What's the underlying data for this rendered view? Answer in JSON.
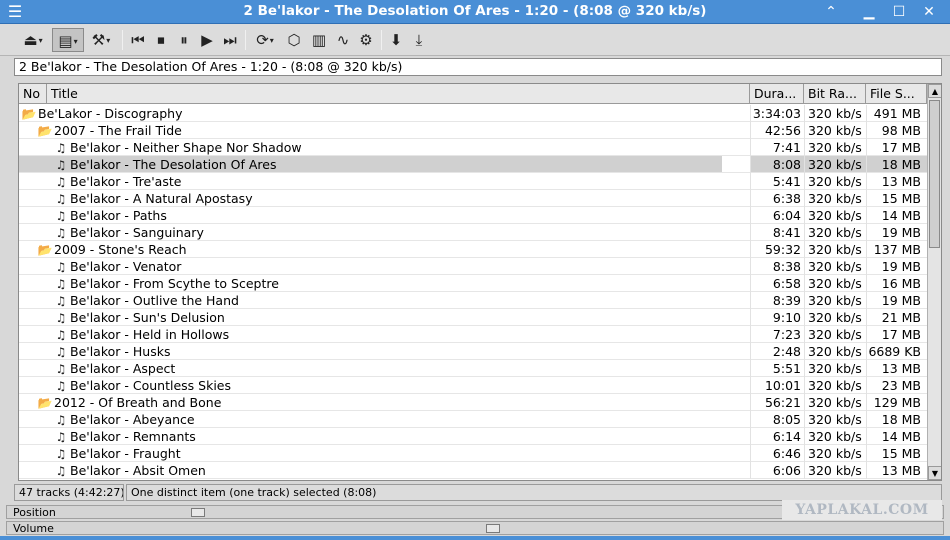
{
  "window": {
    "title": "2 Be'lakor - The Desolation Of Ares - 1:20 - (8:08 @ 320 kb/s)",
    "menu_icon": "hamburger-icon",
    "controls": [
      "minimize-icon",
      "restore-icon",
      "maximize-icon",
      "close-icon"
    ]
  },
  "toolbar": {
    "buttons": [
      {
        "name": "eject-icon",
        "glyph": "⏏",
        "dropdown": true
      },
      {
        "name": "playlist-icon",
        "glyph": "▤",
        "dropdown": true,
        "pressed": true
      },
      {
        "name": "tools-icon",
        "glyph": "⚒",
        "dropdown": true
      },
      {
        "name": "previous-icon",
        "glyph": "⏮"
      },
      {
        "name": "stop-icon",
        "glyph": "⏹"
      },
      {
        "name": "pause-icon",
        "glyph": "⏸"
      },
      {
        "name": "play-icon",
        "glyph": "▶"
      },
      {
        "name": "next-icon",
        "glyph": "⏭"
      },
      {
        "name": "repeat-icon",
        "glyph": "⟳",
        "dropdown": true
      },
      {
        "name": "cube-icon",
        "glyph": "⬡"
      },
      {
        "name": "equalizer-icon",
        "glyph": "▥"
      },
      {
        "name": "waveform-icon",
        "glyph": "∿"
      },
      {
        "name": "settings-icon",
        "glyph": "⚙"
      },
      {
        "name": "download-icon",
        "glyph": "⬇"
      },
      {
        "name": "save-icon",
        "glyph": "⤓"
      }
    ]
  },
  "now_playing": "2 Be'lakor - The Desolation Of Ares - 1:20 - (8:08 @ 320 kb/s)",
  "columns": {
    "no": "No",
    "title": "Title",
    "duration": "Dura...",
    "bitrate": "Bit Ra...",
    "filesize": "File S..."
  },
  "rows": [
    {
      "type": "folder",
      "level": 0,
      "title": "Be'Lakor - Discography",
      "duration": "3:34:03",
      "bitrate": "320 kb/s",
      "size": "491 MB"
    },
    {
      "type": "folder",
      "level": 1,
      "title": "2007 - The Frail Tide",
      "duration": "42:56",
      "bitrate": "320 kb/s",
      "size": "98 MB"
    },
    {
      "type": "track",
      "level": 2,
      "title": "Be'lakor - Neither Shape Nor Shadow",
      "duration": "7:41",
      "bitrate": "320 kb/s",
      "size": "17 MB"
    },
    {
      "type": "track",
      "level": 2,
      "title": "Be'lakor - The Desolation Of Ares",
      "duration": "8:08",
      "bitrate": "320 kb/s",
      "size": "18 MB",
      "selected": true
    },
    {
      "type": "track",
      "level": 2,
      "title": "Be'lakor - Tre'aste",
      "duration": "5:41",
      "bitrate": "320 kb/s",
      "size": "13 MB"
    },
    {
      "type": "track",
      "level": 2,
      "title": "Be'lakor - A Natural Apostasy",
      "duration": "6:38",
      "bitrate": "320 kb/s",
      "size": "15 MB"
    },
    {
      "type": "track",
      "level": 2,
      "title": "Be'lakor - Paths",
      "duration": "6:04",
      "bitrate": "320 kb/s",
      "size": "14 MB"
    },
    {
      "type": "track",
      "level": 2,
      "title": "Be'lakor - Sanguinary",
      "duration": "8:41",
      "bitrate": "320 kb/s",
      "size": "19 MB"
    },
    {
      "type": "folder",
      "level": 1,
      "title": "2009 - Stone's Reach",
      "duration": "59:32",
      "bitrate": "320 kb/s",
      "size": "137 MB"
    },
    {
      "type": "track",
      "level": 2,
      "title": "Be'lakor - Venator",
      "duration": "8:38",
      "bitrate": "320 kb/s",
      "size": "19 MB"
    },
    {
      "type": "track",
      "level": 2,
      "title": "Be'lakor - From Scythe to Sceptre",
      "duration": "6:58",
      "bitrate": "320 kb/s",
      "size": "16 MB"
    },
    {
      "type": "track",
      "level": 2,
      "title": "Be'lakor - Outlive the Hand",
      "duration": "8:39",
      "bitrate": "320 kb/s",
      "size": "19 MB"
    },
    {
      "type": "track",
      "level": 2,
      "title": "Be'lakor - Sun's Delusion",
      "duration": "9:10",
      "bitrate": "320 kb/s",
      "size": "21 MB"
    },
    {
      "type": "track",
      "level": 2,
      "title": "Be'lakor - Held in Hollows",
      "duration": "7:23",
      "bitrate": "320 kb/s",
      "size": "17 MB"
    },
    {
      "type": "track",
      "level": 2,
      "title": "Be'lakor - Husks",
      "duration": "2:48",
      "bitrate": "320 kb/s",
      "size": "6689 KB"
    },
    {
      "type": "track",
      "level": 2,
      "title": "Be'lakor - Aspect",
      "duration": "5:51",
      "bitrate": "320 kb/s",
      "size": "13 MB"
    },
    {
      "type": "track",
      "level": 2,
      "title": "Be'lakor - Countless Skies",
      "duration": "10:01",
      "bitrate": "320 kb/s",
      "size": "23 MB"
    },
    {
      "type": "folder",
      "level": 1,
      "title": "2012 - Of Breath and Bone",
      "duration": "56:21",
      "bitrate": "320 kb/s",
      "size": "129 MB"
    },
    {
      "type": "track",
      "level": 2,
      "title": "Be'lakor - Abeyance",
      "duration": "8:05",
      "bitrate": "320 kb/s",
      "size": "18 MB"
    },
    {
      "type": "track",
      "level": 2,
      "title": "Be'lakor - Remnants",
      "duration": "6:14",
      "bitrate": "320 kb/s",
      "size": "14 MB"
    },
    {
      "type": "track",
      "level": 2,
      "title": "Be'lakor - Fraught",
      "duration": "6:46",
      "bitrate": "320 kb/s",
      "size": "15 MB"
    },
    {
      "type": "track",
      "level": 2,
      "title": "Be'lakor - Absit Omen",
      "duration": "6:06",
      "bitrate": "320 kb/s",
      "size": "13 MB"
    }
  ],
  "status": {
    "tracks": "47 tracks (4:42:27)",
    "selection": "One distinct item (one track) selected (8:08)"
  },
  "position": {
    "label": "Position",
    "value": 0.2
  },
  "volume": {
    "label": "Volume",
    "value": 0.52
  },
  "watermark": "YAPLAKAL.COM",
  "colors": {
    "titlebar": "#4a8fd6",
    "selection": "#d0d0d0",
    "folder": "#b07a10"
  }
}
